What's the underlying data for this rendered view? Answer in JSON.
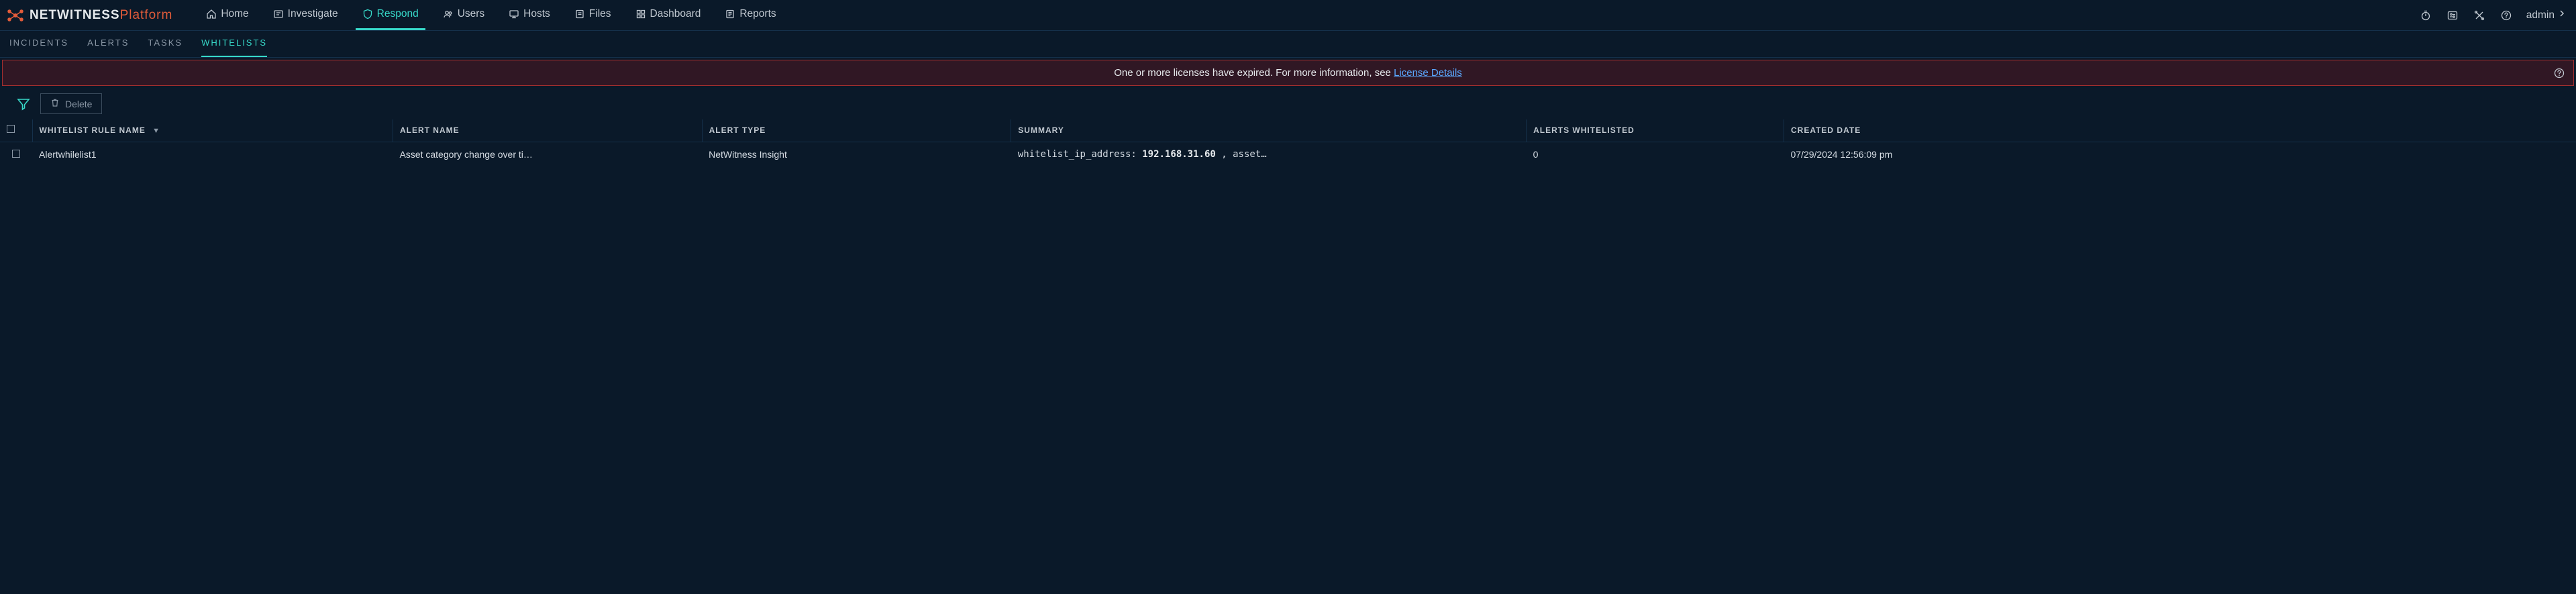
{
  "brand": {
    "primary": "NETWITNESS",
    "secondary": "Platform"
  },
  "nav": {
    "items": [
      {
        "label": "Home"
      },
      {
        "label": "Investigate"
      },
      {
        "label": "Respond",
        "active": true
      },
      {
        "label": "Users"
      },
      {
        "label": "Hosts"
      },
      {
        "label": "Files"
      },
      {
        "label": "Dashboard"
      },
      {
        "label": "Reports"
      }
    ],
    "user": "admin"
  },
  "subnav": {
    "items": [
      {
        "label": "INCIDENTS"
      },
      {
        "label": "ALERTS"
      },
      {
        "label": "TASKS"
      },
      {
        "label": "WHITELISTS",
        "active": true
      }
    ]
  },
  "banner": {
    "text_prefix": "One or more licenses have expired. For more information, see ",
    "link_text": "License Details"
  },
  "toolbar": {
    "delete_label": "Delete"
  },
  "table": {
    "columns": {
      "name": "WHITELIST RULE NAME",
      "alert": "ALERT NAME",
      "type": "ALERT TYPE",
      "summary": "SUMMARY",
      "count": "ALERTS WHITELISTED",
      "date": "CREATED DATE"
    },
    "rows": [
      {
        "name": "Alertwhilelist1",
        "alert": "Asset category change over ti…",
        "type": "NetWitness Insight",
        "summary_key": "whitelist_ip_address:",
        "summary_value": "192.168.31.60",
        "summary_suffix": " , asset…",
        "count": "0",
        "date": "07/29/2024 12:56:09 pm"
      }
    ]
  }
}
